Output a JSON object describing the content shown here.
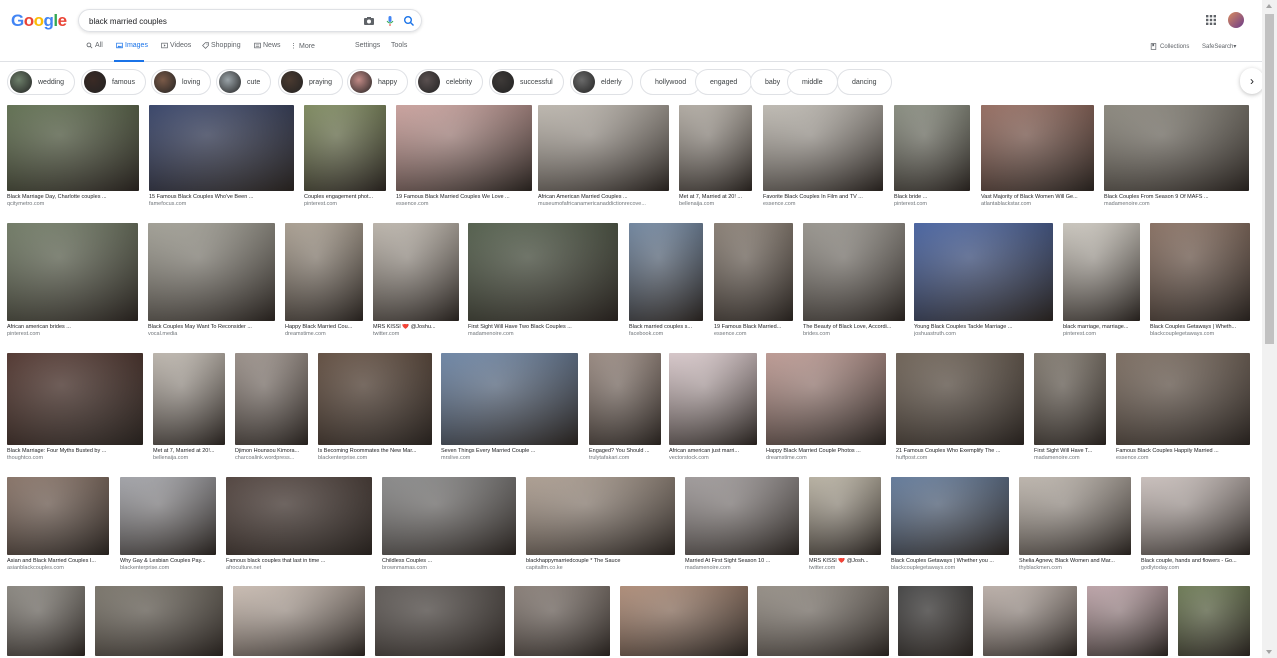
{
  "logo": {
    "letters": [
      "G",
      "o",
      "o",
      "g",
      "l",
      "e"
    ],
    "colors": [
      "#4285f4",
      "#ea4335",
      "#fbbc05",
      "#4285f4",
      "#34a853",
      "#ea4335"
    ]
  },
  "search": {
    "query": "black married couples"
  },
  "nav": {
    "tabs": [
      {
        "label": "All",
        "icon": "search-icon"
      },
      {
        "label": "Images",
        "icon": "image-icon",
        "active": true
      },
      {
        "label": "Videos",
        "icon": "video-icon"
      },
      {
        "label": "Shopping",
        "icon": "tag-icon"
      },
      {
        "label": "News",
        "icon": "news-icon"
      },
      {
        "label": "More",
        "icon": "more-icon"
      }
    ],
    "settings": "Settings",
    "tools": "Tools"
  },
  "right": {
    "collections": "Collections",
    "safesearch": "SafeSearch"
  },
  "chips": [
    {
      "label": "wedding",
      "thumb": "#6d7f6a"
    },
    {
      "label": "famous",
      "thumb": "#3a2a25"
    },
    {
      "label": "loving",
      "thumb": "#7a5a48"
    },
    {
      "label": "cute",
      "thumb": "#9aa3a8"
    },
    {
      "label": "praying",
      "thumb": "#4a3a30"
    },
    {
      "label": "happy",
      "thumb": "#c28a86"
    },
    {
      "label": "celebrity",
      "thumb": "#5a5050"
    },
    {
      "label": "successful",
      "thumb": "#3e3a38"
    },
    {
      "label": "elderly",
      "thumb": "#6a6a6a"
    },
    {
      "label": "hollywood",
      "thumb": null
    },
    {
      "label": "engaged",
      "thumb": null
    },
    {
      "label": "baby",
      "thumb": null
    },
    {
      "label": "middle",
      "thumb": null
    },
    {
      "label": "dancing",
      "thumb": null
    }
  ],
  "rows": [
    [
      {
        "cap": "Black Marriage Day, Charlotte couples ...",
        "src": "qcitymetro.com",
        "color": "#5c6e4a"
      },
      {
        "cap": "15 Famous Black Couples Who've Been ...",
        "src": "famefocus.com",
        "color": "#2b3a66"
      },
      {
        "cap": "Couples engagement phot...",
        "src": "pinterest.com",
        "color": "#7e8c5a"
      },
      {
        "cap": "19 Famous Black Married Couples We Love ...",
        "src": "essence.com",
        "color": "#d9a9a4"
      },
      {
        "cap": "African American Married Couples ...",
        "src": "museumofafricanamericanaddictionrecove...",
        "color": "#c9c2b8"
      },
      {
        "cap": "Met at 7, Married at 20! ...",
        "src": "bellenaija.com",
        "color": "#b9b2a8"
      },
      {
        "cap": "Favorite Black Couples In Film and TV ...",
        "src": "essence.com",
        "color": "#cbc6bd"
      },
      {
        "cap": "Black bride ...",
        "src": "pinterest.com",
        "color": "#8a8f80"
      },
      {
        "cap": "Vast Majority of Black Women Will Ge...",
        "src": "atlantablackstar.com",
        "color": "#9a6a5c"
      },
      {
        "cap": "Black Couples From Season 9 Of MAFS ...",
        "src": "madamenoire.com",
        "color": "#8e8a7e"
      }
    ],
    [
      {
        "cap": "African american brides ...",
        "src": "pinterest.com",
        "color": "#6f7b62"
      },
      {
        "cap": "Black Couples May Want To Reconsider ...",
        "src": "vocal.media",
        "color": "#a8a69a"
      },
      {
        "cap": "Happy Black Married Cou...",
        "src": "dreamstime.com",
        "color": "#b0a494"
      },
      {
        "cap": "MRS KISSI ❤️ @Joshu...",
        "src": "twitter.com",
        "color": "#c6beb3"
      },
      {
        "cap": "First Sight Will Have Two Black Couples ...",
        "src": "madamenoire.com",
        "color": "#4c5a44"
      },
      {
        "cap": "Black married couples s...",
        "src": "facebook.com",
        "color": "#6d86a4"
      },
      {
        "cap": "19 Famous Black Married...",
        "src": "essence.com",
        "color": "#8a7e72"
      },
      {
        "cap": "The Beauty of Black Love, Accordi...",
        "src": "brides.com",
        "color": "#9c9890"
      },
      {
        "cap": "Young Black Couples Tackle Marriage ...",
        "src": "joshuastruth.com",
        "color": "#3f5fa8"
      },
      {
        "cap": "black marriage, marriage...",
        "src": "pinterest.com",
        "color": "#d7d2c8"
      },
      {
        "cap": "Black Couples Getaways | Wheth...",
        "src": "blackcouplegetaways.com",
        "color": "#8a6e5e"
      }
    ],
    [
      {
        "cap": "Black Marriage: Four Myths Busted by ...",
        "src": "thoughtco.com",
        "color": "#4a2a22"
      },
      {
        "cap": "Met at 7, Married at 20!...",
        "src": "bellenaija.com",
        "color": "#c7bfb5"
      },
      {
        "cap": "Djimon Hounsou Kimora...",
        "src": "charcoalink.wordpress...",
        "color": "#9e928a"
      },
      {
        "cap": "Is Becoming Roommates the New Mar...",
        "src": "blackenterprise.com",
        "color": "#5d4636"
      },
      {
        "cap": "Seven Things Every Married Couple ...",
        "src": "mrslive.com",
        "color": "#6a87ad"
      },
      {
        "cap": "Engaged? You Should ...",
        "src": "trulytafakari.com",
        "color": "#9c8a80"
      },
      {
        "cap": "African american just marri...",
        "src": "vectorstock.com",
        "color": "#e8d5d8"
      },
      {
        "cap": "Happy Black Married Couple Photos ...",
        "src": "dreamstime.com",
        "color": "#c9a098"
      },
      {
        "cap": "21 Famous Couples Who Exemplify The ...",
        "src": "huffpost.com",
        "color": "#6c5e50"
      },
      {
        "cap": "First Sight Will Have T...",
        "src": "madamenoire.com",
        "color": "#7d7468"
      },
      {
        "cap": "Famous Black Couples Happily Married ...",
        "src": "essence.com",
        "color": "#7b6a5c"
      }
    ],
    [
      {
        "cap": "Asian and Black Married Couples I...",
        "src": "asianblackcouples.com",
        "color": "#8a7264"
      },
      {
        "cap": "Why Gay & Lesbian Couples Pay...",
        "src": "blackenterprise.com",
        "color": "#a9aab0"
      },
      {
        "cap": "Famous black couples that last in time ...",
        "src": "afroculture.net",
        "color": "#4a3a34"
      },
      {
        "cap": "Childless Couples ...",
        "src": "brownmamas.com",
        "color": "#8c8c8c"
      },
      {
        "cap": "blackhappymarriedcouple * The Sauce",
        "src": "capitalfm.co.ke",
        "color": "#b6a596"
      },
      {
        "cap": "Married At First Sight Season 10 ...",
        "src": "madamenoire.com",
        "color": "#a6a0a0"
      },
      {
        "cap": "MRS KISSI ❤️ @Josh...",
        "src": "twitter.com",
        "color": "#c2baa8"
      },
      {
        "cap": "Black Couples Getaways | Whether you ...",
        "src": "blackcouplegetaways.com",
        "color": "#5e7aa0"
      },
      {
        "cap": "Shelia Agnew, Black Women and Mar...",
        "src": "thyblackmen.com",
        "color": "#c9c0b6"
      },
      {
        "cap": "Black couple, hands and flowers - Go...",
        "src": "godlytoday.com",
        "color": "#d8ccc8"
      }
    ],
    [
      {
        "cap": "",
        "src": "",
        "color": "#8c8880"
      },
      {
        "cap": "",
        "src": "",
        "color": "#7a7468"
      },
      {
        "cap": "",
        "src": "",
        "color": "#d8c8bc"
      },
      {
        "cap": "",
        "src": "",
        "color": "#5a5450"
      },
      {
        "cap": "",
        "src": "",
        "color": "#8a7e76"
      },
      {
        "cap": "",
        "src": "",
        "color": "#b89078"
      },
      {
        "cap": "",
        "src": "",
        "color": "#9a9288"
      },
      {
        "cap": "",
        "src": "",
        "color": "#3a3a3a"
      },
      {
        "cap": "",
        "src": "",
        "color": "#c6b8b0"
      },
      {
        "cap": "",
        "src": "",
        "color": "#c8aab0"
      },
      {
        "cap": "",
        "src": "",
        "color": "#6a7a4e"
      }
    ]
  ]
}
